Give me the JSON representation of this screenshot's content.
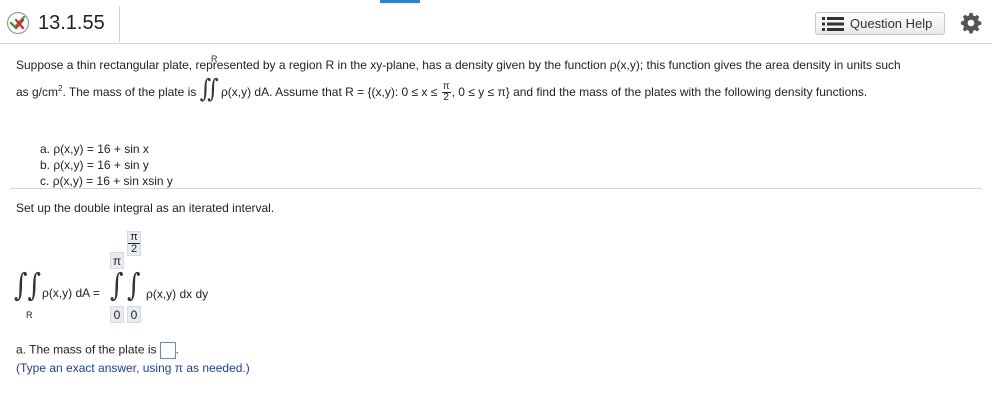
{
  "header": {
    "status_icon": "partially-correct-icon",
    "problem_number": "13.1.55",
    "help_label": "Question Help",
    "help_icon": "list-icon",
    "settings_icon": "gear-icon",
    "colors": {
      "accent": "#2e7fd6",
      "incorrect": "#d9262e",
      "correct": "#3aa33a",
      "hint_text": "#1a3fa8"
    }
  },
  "prompt": {
    "line1": "Suppose a thin rectangular plate, represented by a region R in the xy-plane, has a density given by the function ρ(x,y); this function gives the area density in units such",
    "line2_a": "as g/cm",
    "line2_sup": "2",
    "line2_b": ". The mass of the plate is ",
    "integrand": "ρ(x,y) dA. Assume that R = {(x,y): 0 ≤ x ≤",
    "frac_num": "π",
    "frac_den": "2",
    "line2_c": ", 0 ≤ y ≤ π} and find the mass of the plates with the following density functions.",
    "region_label": "R"
  },
  "parts": [
    {
      "label": "a.",
      "expr": "ρ(x,y) = 16 + sin x"
    },
    {
      "label": "b.",
      "expr": "ρ(x,y) = 16 + sin y"
    },
    {
      "label": "c.",
      "expr": "ρ(x,y) = 16 + sin xsin y"
    }
  ],
  "setup_text": "Set up the double integral as an iterated interval.",
  "integral": {
    "lhs": "ρ(x,y) dA =",
    "region": "R",
    "outer_upper": "π",
    "outer_lower": "0",
    "inner_upper_num": "π",
    "inner_upper_den": "2",
    "inner_lower": "0",
    "integrand": "ρ(x,y) dx dy"
  },
  "answer": {
    "prompt": "a. The mass of the plate is",
    "value": "",
    "suffix": ".",
    "hint": "(Type an exact answer, using π as needed.)"
  }
}
